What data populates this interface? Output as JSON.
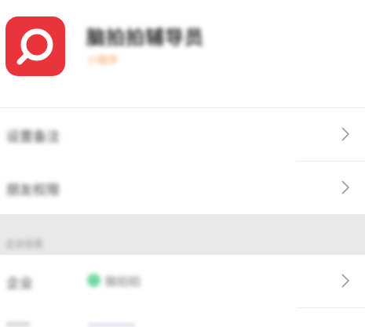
{
  "header": {
    "title": "脑拍拍辅导员",
    "subtitle": "小程序",
    "icon": "search-magnifier-icon",
    "icon_color": "#e9343b"
  },
  "rows": [
    {
      "label": "设置备注",
      "chevron": "chevron-right-icon"
    },
    {
      "label": "朋友权限",
      "chevron": "chevron-right-icon"
    }
  ],
  "section": {
    "label": "企业信息"
  },
  "company_row": {
    "label": "企业",
    "value": "脑拍拍",
    "status_color": "#70d9a2",
    "chevron": "chevron-right-icon"
  }
}
